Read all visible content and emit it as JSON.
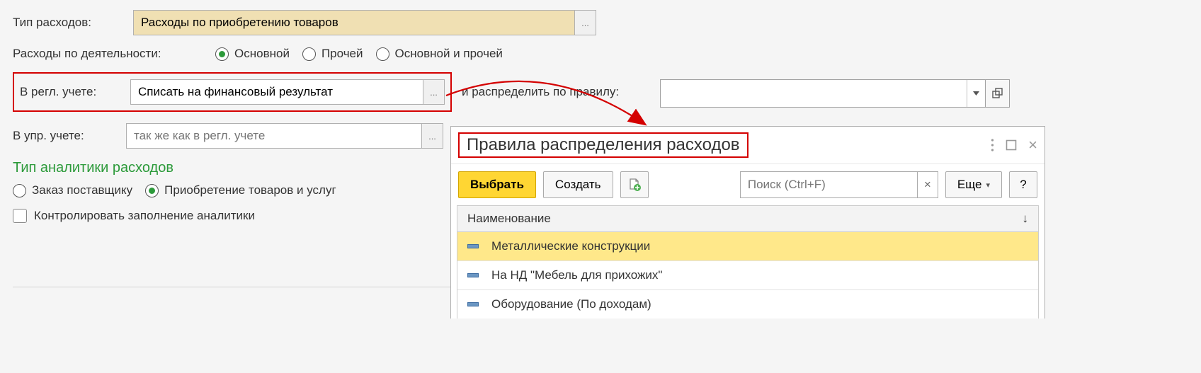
{
  "expense_type": {
    "label": "Тип расходов:",
    "value": "Расходы по приобретению товаров"
  },
  "activity": {
    "label": "Расходы по деятельности:",
    "options": [
      "Основной",
      "Прочей",
      "Основной и прочей"
    ],
    "selected": 0
  },
  "reg_acc": {
    "label": "В регл. учете:",
    "value": "Списать на финансовый результат",
    "rule_label": "и распределить по правилу:",
    "rule_value": ""
  },
  "mgr_acc": {
    "label": "В упр. учете:",
    "placeholder": "так же как в регл. учете",
    "value": ""
  },
  "analytics": {
    "header": "Тип аналитики расходов",
    "options": [
      "Заказ поставщику",
      "Приобретение товаров и услуг"
    ],
    "selected": 1,
    "checkbox_label": "Контролировать заполнение аналитики"
  },
  "popup": {
    "title": "Правила распределения расходов",
    "select_btn": "Выбрать",
    "create_btn": "Создать",
    "search_placeholder": "Поиск (Ctrl+F)",
    "more_btn": "Еще",
    "help_btn": "?",
    "column_header": "Наименование",
    "items": [
      "Металлические конструкции",
      "На НД \"Мебель для прихожих\"",
      "Оборудование (По доходам)"
    ],
    "selected_item": 0
  },
  "icons": {
    "ellipsis": "...",
    "close": "×",
    "sort_arrow": "↓"
  }
}
